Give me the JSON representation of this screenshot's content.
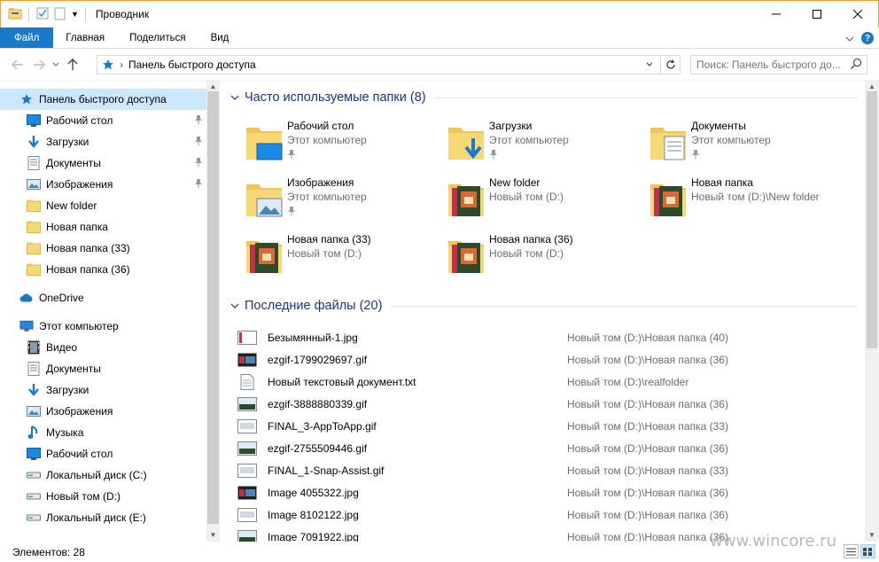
{
  "window": {
    "title": "Проводник",
    "controls": {
      "minimize": "—",
      "maximize": "☐",
      "close": "✕"
    }
  },
  "ribbon": {
    "tabs": [
      {
        "label": "Файл"
      },
      {
        "label": "Главная"
      },
      {
        "label": "Поделиться"
      },
      {
        "label": "Вид"
      }
    ],
    "help": "?",
    "expand": "⌄"
  },
  "address": {
    "path": "Панель быстрого доступа",
    "separator": "›",
    "search_placeholder": "Поиск: Панель быстрого до..."
  },
  "nav": {
    "items": [
      {
        "label": "Панель быстрого доступа",
        "icon": "star-icon"
      },
      {
        "label": "Рабочий стол",
        "icon": "desktop-icon",
        "pinned": true
      },
      {
        "label": "Загрузки",
        "icon": "download-icon",
        "pinned": true
      },
      {
        "label": "Документы",
        "icon": "document-icon",
        "pinned": true
      },
      {
        "label": "Изображения",
        "icon": "pictures-icon",
        "pinned": true
      },
      {
        "label": "New folder",
        "icon": "folder-icon"
      },
      {
        "label": "Новая папка",
        "icon": "folder-icon"
      },
      {
        "label": "Новая папка (33)",
        "icon": "folder-icon"
      },
      {
        "label": "Новая папка (36)",
        "icon": "folder-icon"
      },
      {
        "label": "OneDrive",
        "icon": "cloud-icon"
      },
      {
        "label": "Этот компьютер",
        "icon": "computer-icon"
      },
      {
        "label": "Видео",
        "icon": "video-icon"
      },
      {
        "label": "Документы",
        "icon": "document-icon"
      },
      {
        "label": "Загрузки",
        "icon": "download-icon"
      },
      {
        "label": "Изображения",
        "icon": "pictures-icon"
      },
      {
        "label": "Музыка",
        "icon": "music-icon"
      },
      {
        "label": "Рабочий стол",
        "icon": "desktop-icon"
      },
      {
        "label": "Локальный диск (C:)",
        "icon": "drive-icon"
      },
      {
        "label": "Новый том (D:)",
        "icon": "drive-icon"
      },
      {
        "label": "Локальный диск (E:)",
        "icon": "drive-icon"
      }
    ]
  },
  "frequent": {
    "header": "Часто используемые папки (8)",
    "folders": [
      {
        "name": "Рабочий стол",
        "sub": "Этот компьютер",
        "pinned": true,
        "kind": "desktop"
      },
      {
        "name": "Загрузки",
        "sub": "Этот компьютер",
        "pinned": true,
        "kind": "downloads"
      },
      {
        "name": "Документы",
        "sub": "Этот компьютер",
        "pinned": true,
        "kind": "documents"
      },
      {
        "name": "Изображения",
        "sub": "Этот компьютер",
        "pinned": true,
        "kind": "pictures"
      },
      {
        "name": "New folder",
        "sub": "Новый том (D:)",
        "kind": "photo"
      },
      {
        "name": "Новая папка",
        "sub": "Новый том (D:)\\New folder",
        "kind": "photo"
      },
      {
        "name": "Новая папка (33)",
        "sub": "Новый том (D:)",
        "kind": "photo"
      },
      {
        "name": "Новая папка (36)",
        "sub": "Новый том (D:)",
        "kind": "photo"
      }
    ]
  },
  "recent": {
    "header": "Последние файлы (20)",
    "files": [
      {
        "name": "Безымянный-1.jpg",
        "path": "Новый том (D:)\\Новая папка (40)"
      },
      {
        "name": "ezgif-1799029697.gif",
        "path": "Новый том (D:)\\Новая папка (36)"
      },
      {
        "name": "Новый текстовый документ.txt",
        "path": "Новый том (D:)\\realfolder"
      },
      {
        "name": "ezgif-3888880339.gif",
        "path": "Новый том (D:)\\Новая папка (36)"
      },
      {
        "name": "FINAL_3-AppToApp.gif",
        "path": "Новый том (D:)\\Новая папка (33)"
      },
      {
        "name": "ezgif-2755509446.gif",
        "path": "Новый том (D:)\\Новая папка (36)"
      },
      {
        "name": "FINAL_1-Snap-Assist.gif",
        "path": "Новый том (D:)\\Новая папка (33)"
      },
      {
        "name": "Image 4055322.jpg",
        "path": "Новый том (D:)\\Новая папка (36)"
      },
      {
        "name": "Image 8102122.jpg",
        "path": "Новый том (D:)\\Новая папка (36)"
      },
      {
        "name": "Image 7091922.jpg",
        "path": "Новый том (D:)\\Новая папка (36)"
      }
    ]
  },
  "status": {
    "count": "Элементов: 28",
    "watermark": "www.wincore.ru"
  },
  "colors": {
    "accent": "#1979ca",
    "selected": "#cce8ff",
    "folder": "#f8d775",
    "header_text": "#1e3287"
  }
}
